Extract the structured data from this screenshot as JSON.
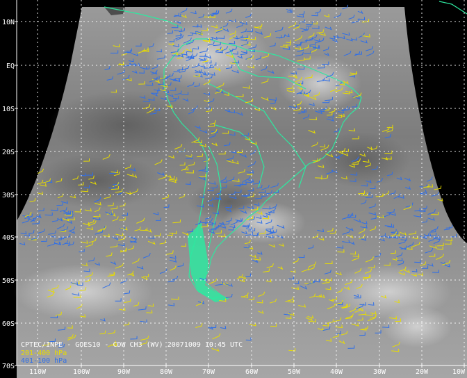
{
  "title": "CPTEC/INPE - GOES10 - CDW CH3 (WV) 20071009 10:45 UTC",
  "legend": [
    {
      "label": "201-400 hPa",
      "color": "#e8dc00"
    },
    {
      "label": "401-100 hPa",
      "color": "#2f6fe8"
    }
  ],
  "axes": {
    "lat_labels": [
      "10N",
      "EQ",
      "10S",
      "20S",
      "30S",
      "40S",
      "50S",
      "60S",
      "70S"
    ],
    "lon_labels": [
      "110W",
      "100W",
      "90W",
      "80W",
      "70W",
      "60W",
      "50W",
      "40W",
      "30W",
      "20W",
      "10W"
    ]
  },
  "colors": {
    "background": "#000000",
    "coastline": "#2ee8a0",
    "grid": "#ffffff",
    "imagery": "#8c8c8c"
  }
}
